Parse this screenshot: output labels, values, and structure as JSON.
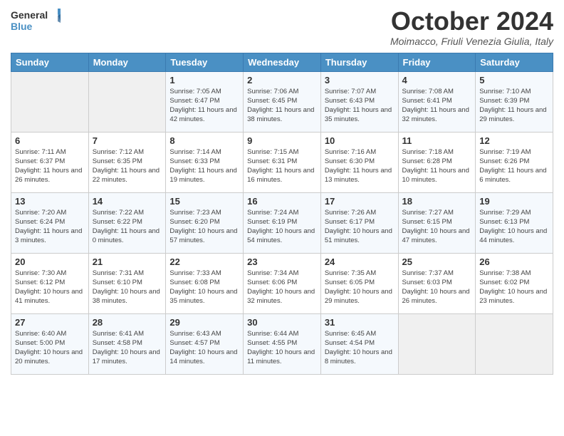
{
  "logo": {
    "line1": "General",
    "line2": "Blue"
  },
  "title": "October 2024",
  "subtitle": "Moimacco, Friuli Venezia Giulia, Italy",
  "days_of_week": [
    "Sunday",
    "Monday",
    "Tuesday",
    "Wednesday",
    "Thursday",
    "Friday",
    "Saturday"
  ],
  "weeks": [
    [
      {
        "day": "",
        "info": ""
      },
      {
        "day": "",
        "info": ""
      },
      {
        "day": "1",
        "info": "Sunrise: 7:05 AM\nSunset: 6:47 PM\nDaylight: 11 hours and 42 minutes."
      },
      {
        "day": "2",
        "info": "Sunrise: 7:06 AM\nSunset: 6:45 PM\nDaylight: 11 hours and 38 minutes."
      },
      {
        "day": "3",
        "info": "Sunrise: 7:07 AM\nSunset: 6:43 PM\nDaylight: 11 hours and 35 minutes."
      },
      {
        "day": "4",
        "info": "Sunrise: 7:08 AM\nSunset: 6:41 PM\nDaylight: 11 hours and 32 minutes."
      },
      {
        "day": "5",
        "info": "Sunrise: 7:10 AM\nSunset: 6:39 PM\nDaylight: 11 hours and 29 minutes."
      }
    ],
    [
      {
        "day": "6",
        "info": "Sunrise: 7:11 AM\nSunset: 6:37 PM\nDaylight: 11 hours and 26 minutes."
      },
      {
        "day": "7",
        "info": "Sunrise: 7:12 AM\nSunset: 6:35 PM\nDaylight: 11 hours and 22 minutes."
      },
      {
        "day": "8",
        "info": "Sunrise: 7:14 AM\nSunset: 6:33 PM\nDaylight: 11 hours and 19 minutes."
      },
      {
        "day": "9",
        "info": "Sunrise: 7:15 AM\nSunset: 6:31 PM\nDaylight: 11 hours and 16 minutes."
      },
      {
        "day": "10",
        "info": "Sunrise: 7:16 AM\nSunset: 6:30 PM\nDaylight: 11 hours and 13 minutes."
      },
      {
        "day": "11",
        "info": "Sunrise: 7:18 AM\nSunset: 6:28 PM\nDaylight: 11 hours and 10 minutes."
      },
      {
        "day": "12",
        "info": "Sunrise: 7:19 AM\nSunset: 6:26 PM\nDaylight: 11 hours and 6 minutes."
      }
    ],
    [
      {
        "day": "13",
        "info": "Sunrise: 7:20 AM\nSunset: 6:24 PM\nDaylight: 11 hours and 3 minutes."
      },
      {
        "day": "14",
        "info": "Sunrise: 7:22 AM\nSunset: 6:22 PM\nDaylight: 11 hours and 0 minutes."
      },
      {
        "day": "15",
        "info": "Sunrise: 7:23 AM\nSunset: 6:20 PM\nDaylight: 10 hours and 57 minutes."
      },
      {
        "day": "16",
        "info": "Sunrise: 7:24 AM\nSunset: 6:19 PM\nDaylight: 10 hours and 54 minutes."
      },
      {
        "day": "17",
        "info": "Sunrise: 7:26 AM\nSunset: 6:17 PM\nDaylight: 10 hours and 51 minutes."
      },
      {
        "day": "18",
        "info": "Sunrise: 7:27 AM\nSunset: 6:15 PM\nDaylight: 10 hours and 47 minutes."
      },
      {
        "day": "19",
        "info": "Sunrise: 7:29 AM\nSunset: 6:13 PM\nDaylight: 10 hours and 44 minutes."
      }
    ],
    [
      {
        "day": "20",
        "info": "Sunrise: 7:30 AM\nSunset: 6:12 PM\nDaylight: 10 hours and 41 minutes."
      },
      {
        "day": "21",
        "info": "Sunrise: 7:31 AM\nSunset: 6:10 PM\nDaylight: 10 hours and 38 minutes."
      },
      {
        "day": "22",
        "info": "Sunrise: 7:33 AM\nSunset: 6:08 PM\nDaylight: 10 hours and 35 minutes."
      },
      {
        "day": "23",
        "info": "Sunrise: 7:34 AM\nSunset: 6:06 PM\nDaylight: 10 hours and 32 minutes."
      },
      {
        "day": "24",
        "info": "Sunrise: 7:35 AM\nSunset: 6:05 PM\nDaylight: 10 hours and 29 minutes."
      },
      {
        "day": "25",
        "info": "Sunrise: 7:37 AM\nSunset: 6:03 PM\nDaylight: 10 hours and 26 minutes."
      },
      {
        "day": "26",
        "info": "Sunrise: 7:38 AM\nSunset: 6:02 PM\nDaylight: 10 hours and 23 minutes."
      }
    ],
    [
      {
        "day": "27",
        "info": "Sunrise: 6:40 AM\nSunset: 5:00 PM\nDaylight: 10 hours and 20 minutes."
      },
      {
        "day": "28",
        "info": "Sunrise: 6:41 AM\nSunset: 4:58 PM\nDaylight: 10 hours and 17 minutes."
      },
      {
        "day": "29",
        "info": "Sunrise: 6:43 AM\nSunset: 4:57 PM\nDaylight: 10 hours and 14 minutes."
      },
      {
        "day": "30",
        "info": "Sunrise: 6:44 AM\nSunset: 4:55 PM\nDaylight: 10 hours and 11 minutes."
      },
      {
        "day": "31",
        "info": "Sunrise: 6:45 AM\nSunset: 4:54 PM\nDaylight: 10 hours and 8 minutes."
      },
      {
        "day": "",
        "info": ""
      },
      {
        "day": "",
        "info": ""
      }
    ]
  ]
}
